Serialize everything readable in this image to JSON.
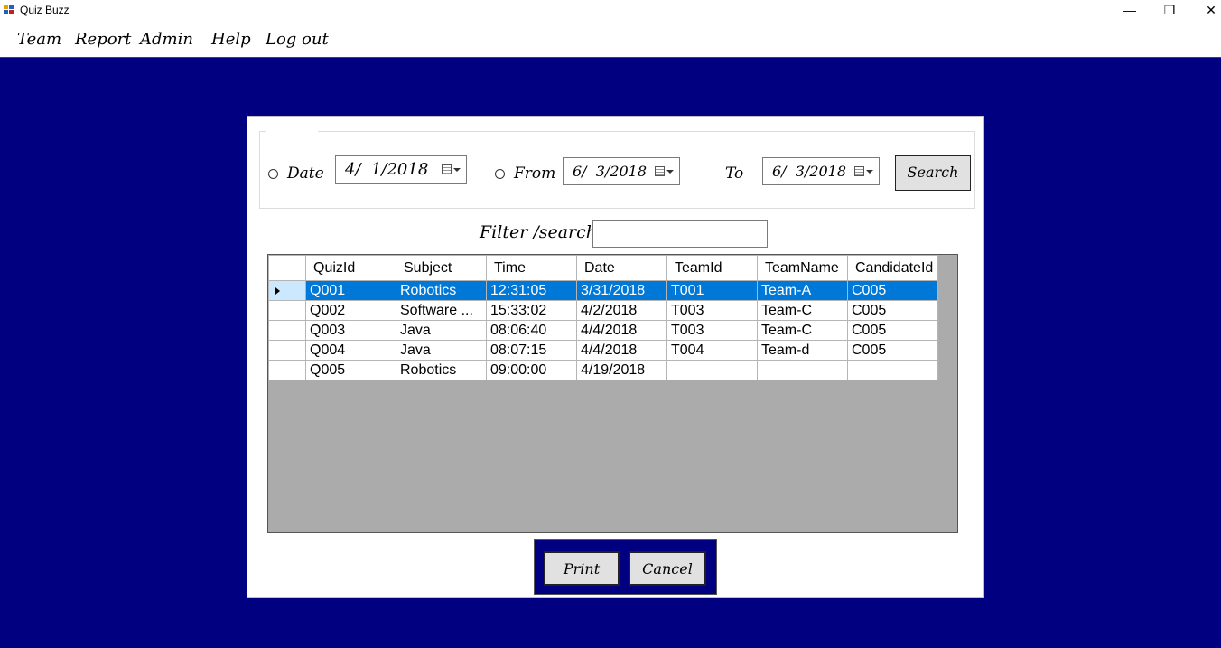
{
  "window": {
    "title": "Quiz Buzz",
    "controls": {
      "minimize": "—",
      "restore": "❐",
      "close": "✕"
    }
  },
  "menu": [
    "Team",
    "Report",
    "Admin",
    "Help",
    "Log out"
  ],
  "filters": {
    "date_label": "Date",
    "date_value": "4/  1/2018",
    "from_label": "From",
    "from_value": "6/  3/2018",
    "to_label": "To",
    "to_value": "6/  3/2018",
    "search_button": "Search",
    "filter_label": "Filter /search",
    "filter_value": ""
  },
  "grid": {
    "columns": [
      "QuizId",
      "Subject",
      "Time",
      "Date",
      "TeamId",
      "TeamName",
      "CandidateId"
    ],
    "rows": [
      [
        "Q001",
        "Robotics",
        "12:31:05",
        "3/31/2018",
        "T001",
        "Team-A",
        "C005"
      ],
      [
        "Q002",
        "Software ...",
        "15:33:02",
        "4/2/2018",
        "T003",
        "Team-C",
        "C005"
      ],
      [
        "Q003",
        "Java",
        "08:06:40",
        "4/4/2018",
        "T003",
        "Team-C",
        "C005"
      ],
      [
        "Q004",
        "Java",
        "08:07:15",
        "4/4/2018",
        "T004",
        "Team-d",
        "C005"
      ],
      [
        "Q005",
        "Robotics",
        "09:00:00",
        "4/19/2018",
        "",
        "",
        ""
      ]
    ],
    "selected_row": 0
  },
  "buttons": {
    "print": "Print",
    "cancel": "Cancel"
  },
  "colors": {
    "workspace": "#000080",
    "selection": "#0078d7",
    "grid_empty": "#ababab"
  }
}
